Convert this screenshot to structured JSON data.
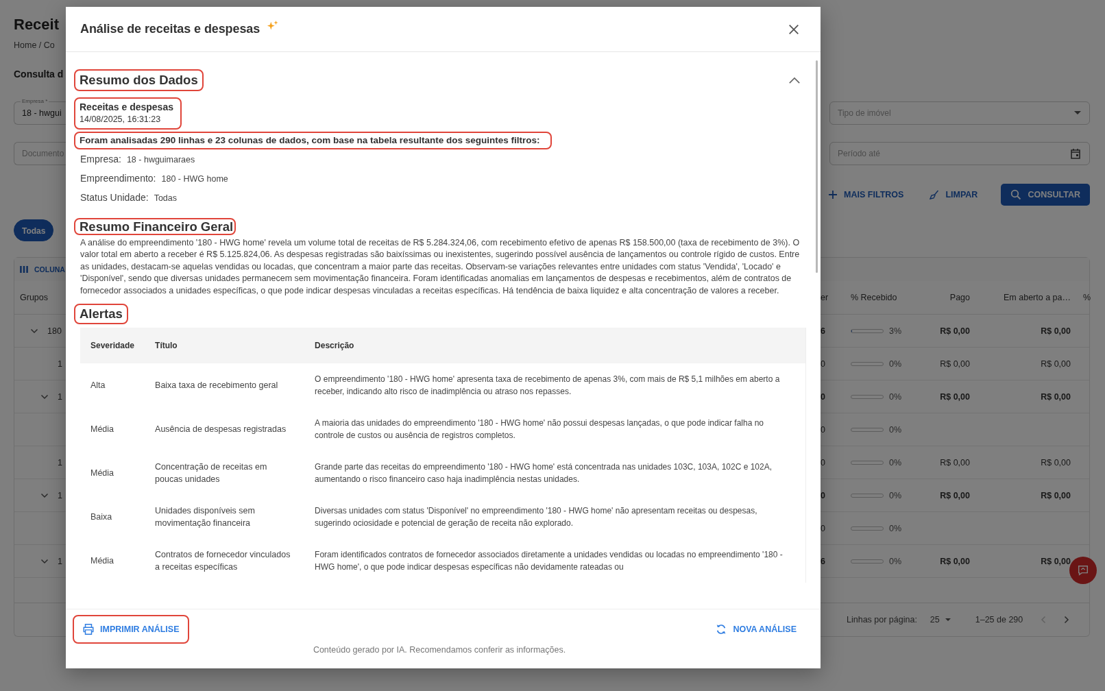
{
  "page": {
    "title": "Receit",
    "breadcrumb": "Home / Co",
    "subtitle": "Consulta d",
    "filters_left": [
      {
        "label": "Empresa *",
        "value": "18 - hwgui"
      },
      {
        "placeholder": "Documento"
      }
    ],
    "filters_right": [
      {
        "kind": "select",
        "placeholder": "Tipo de imóvel"
      },
      {
        "kind": "date",
        "placeholder": "Período até"
      }
    ],
    "actions": [
      {
        "kind": "text",
        "label": "MAIS FILTROS"
      },
      {
        "kind": "text",
        "label": "LIMPAR"
      },
      {
        "kind": "primary",
        "label": "CONSULTAR"
      }
    ],
    "chips": [
      {
        "label": "Todas",
        "selected": true
      }
    ],
    "table": {
      "toolbar": "COLUNA",
      "group_header": "Grupos",
      "columns": [
        "er",
        "% Recebido",
        "Pago",
        "Em aberto a pa…",
        "%"
      ],
      "rows": [
        {
          "label": "180",
          "expanded": true,
          "cut_value": "6",
          "level": 0.03,
          "reading": "3%",
          "pago": "R$ 0,00",
          "aberto": "R$ 0,00",
          "children": [
            {
              "label": "1",
              "cut_value": "0",
              "level": 0,
              "reading": "0%",
              "pago": "R$ 0,00",
              "aberto": "R$ 0,00"
            },
            {
              "label": "1",
              "expanded": true,
              "cut_value": "0",
              "level": 0,
              "reading": "0%",
              "pago": "R$ 0,00",
              "aberto": "R$ 0,00",
              "children": [
                {
                  "cut_value": "0",
                  "level": 0,
                  "reading": "0%"
                }
              ]
            },
            {
              "label": "1",
              "cut_value": "0",
              "level": 0,
              "reading": "0%",
              "pago": "R$ 0,00",
              "aberto": "R$ 0,00"
            },
            {
              "label": "1",
              "expanded": true,
              "cut_value": "0",
              "level": 0,
              "reading": "0%",
              "pago": "R$ 0,00",
              "aberto": "R$ 0,00",
              "children": [
                {
                  "cut_value": "0",
                  "level": 0,
                  "reading": "0%"
                }
              ]
            },
            {
              "label": "1",
              "expanded": true,
              "cut_value": "6",
              "level": 0,
              "reading": "0%",
              "pago": "R$ 0,00",
              "aberto": "R$ 0,00"
            }
          ]
        }
      ]
    },
    "pagination": {
      "rows_label": "Linhas por página:",
      "rows_per_page": "25",
      "range": "1–25 de 290",
      "nav": [
        {
          "kind": "prev",
          "disabled": true
        },
        {
          "kind": "next",
          "disabled": false
        }
      ]
    }
  },
  "dialog": {
    "title": "Análise de receitas e despesas",
    "summary": {
      "title": "Resumo dos Dados",
      "expanded": true,
      "highlighted": true
    },
    "report": {
      "name": "Receitas e despesas",
      "timestamp": "14/08/2025, 16:31:23",
      "highlighted": true
    },
    "scope": {
      "text": "Foram analisadas 290 linhas e 23 colunas de dados, com base na tabela resultante dos seguintes filtros:",
      "highlighted": true
    },
    "filters": [
      {
        "label": "Empresa:",
        "value": "18 - hwguimaraes"
      },
      {
        "label": "Empreendimento:",
        "value": "180 - HWG home"
      },
      {
        "label": "Status Unidade:",
        "value": "Todas"
      }
    ],
    "financial": {
      "title": "Resumo Financeiro Geral",
      "highlighted": true,
      "text": "A análise do empreendimento '180 - HWG home' revela um volume total de receitas de R$ 5.284.324,06, com recebimento efetivo de apenas R$ 158.500,00 (taxa de recebimento de 3%). O valor total em aberto a receber é R$ 5.125.824,06. As despesas registradas são baixíssimas ou inexistentes, sugerindo possível ausência de lançamentos ou controle rígido de custos. Entre as unidades, destacam-se aquelas vendidas ou locadas, que concentram a maior parte das receitas. Observam-se variações relevantes entre unidades com status 'Vendida', 'Locado' e 'Disponível', sendo que diversas unidades permanecem sem movimentação financeira. Foram identificadas anomalias em lançamentos de despesas e recebimentos, além de contratos de fornecedor associados a unidades específicas, o que pode indicar despesas vinculadas a receitas específicas. Há tendência de baixa liquidez e alta concentração de valores a receber."
    },
    "alerts": {
      "title": "Alertas",
      "highlighted": true,
      "columns": [
        "Severidade",
        "Título",
        "Descrição"
      ],
      "rows": [
        [
          "Alta",
          "Baixa taxa de recebimento geral",
          "O empreendimento '180 - HWG home' apresenta taxa de recebimento de apenas 3%, com mais de R$ 5,1 milhões em aberto a receber, indicando alto risco de inadimplência ou atraso nos repasses."
        ],
        [
          "Média",
          "Ausência de despesas registradas",
          "A maioria das unidades do empreendimento '180 - HWG home' não possui despesas lançadas, o que pode indicar falha no controle de custos ou ausência de registros completos."
        ],
        [
          "Média",
          "Concentração de receitas em poucas unidades",
          "Grande parte das receitas do empreendimento '180 - HWG home' está concentrada nas unidades 103C, 103A, 102C e 102A, aumentando o risco financeiro caso haja inadimplência nestas unidades."
        ],
        [
          "Baixa",
          "Unidades disponíveis sem movimentação financeira",
          "Diversas unidades com status 'Disponível' no empreendimento '180 - HWG home' não apresentam receitas ou despesas, sugerindo ociosidade e potencial de geração de receita não explorado."
        ],
        [
          "Média",
          "Contratos de fornecedor vinculados a receitas específicas",
          "Foram identificados contratos de fornecedor associados diretamente a unidades vendidas ou locadas no empreendimento '180 - HWG home', o que pode indicar despesas específicas não devidamente rateadas ou"
        ]
      ]
    },
    "actions": [
      {
        "kind": "print",
        "label": "IMPRIMIR ANÁLISE",
        "highlighted": true
      },
      {
        "kind": "refresh",
        "label": "NOVA ANÁLISE",
        "highlighted": false
      }
    ],
    "disclaimer": "Conteúdo gerado por IA. Recomendamos conferir as informações."
  }
}
